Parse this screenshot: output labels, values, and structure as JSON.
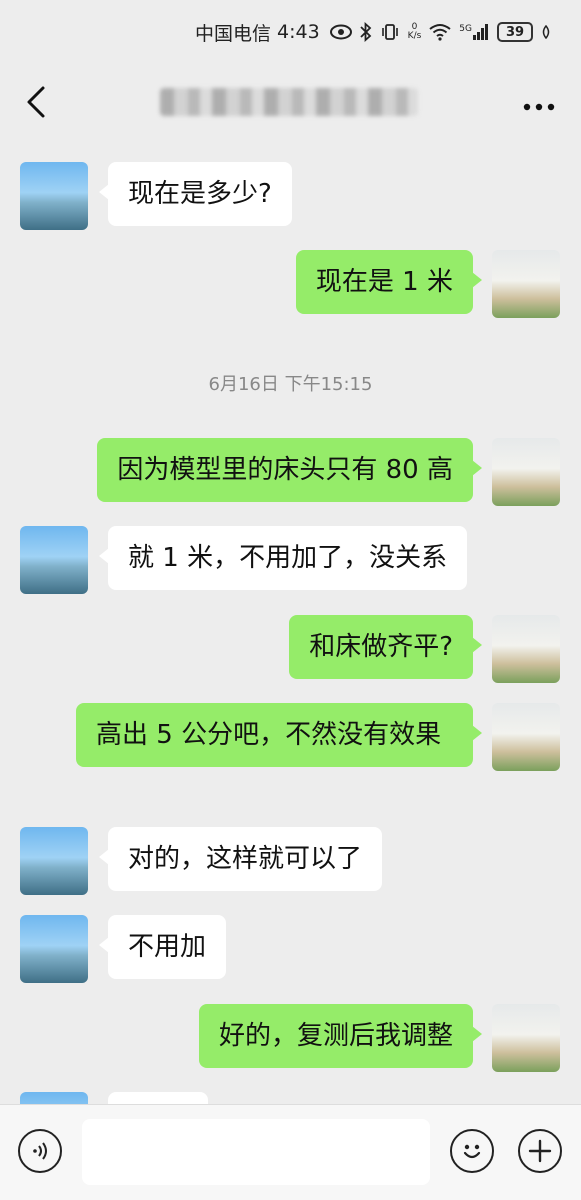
{
  "status_bar": {
    "carrier": "中国电信",
    "time": "4:43",
    "net_speed_value": "0",
    "net_speed_unit": "K/s",
    "network": "5G",
    "battery": "39"
  },
  "nav": {
    "back_icon": "chevron-left-icon",
    "title": "",
    "more_icon": "more-dots-icon"
  },
  "timestamp": "6月16日 下午15:15",
  "messages": [
    {
      "side": "other",
      "text": "现在是多少?"
    },
    {
      "side": "self",
      "text": "现在是 1 米"
    },
    {
      "side": "self",
      "text": "因为模型里的床头只有 80 高"
    },
    {
      "side": "other",
      "text": "就 1 米，不用加了，没关系"
    },
    {
      "side": "self",
      "text": "和床做齐平?"
    },
    {
      "side": "self",
      "text": "高出 5 公分吧，不然没有效果"
    },
    {
      "side": "other",
      "text": "对的，这样就可以了"
    },
    {
      "side": "other",
      "text": "不用加"
    },
    {
      "side": "self",
      "text": "好的，复测后我调整"
    }
  ],
  "input_bar": {
    "voice_icon": "voice-icon",
    "emoji_icon": "emoji-icon",
    "add_icon": "plus-icon",
    "input_value": ""
  }
}
